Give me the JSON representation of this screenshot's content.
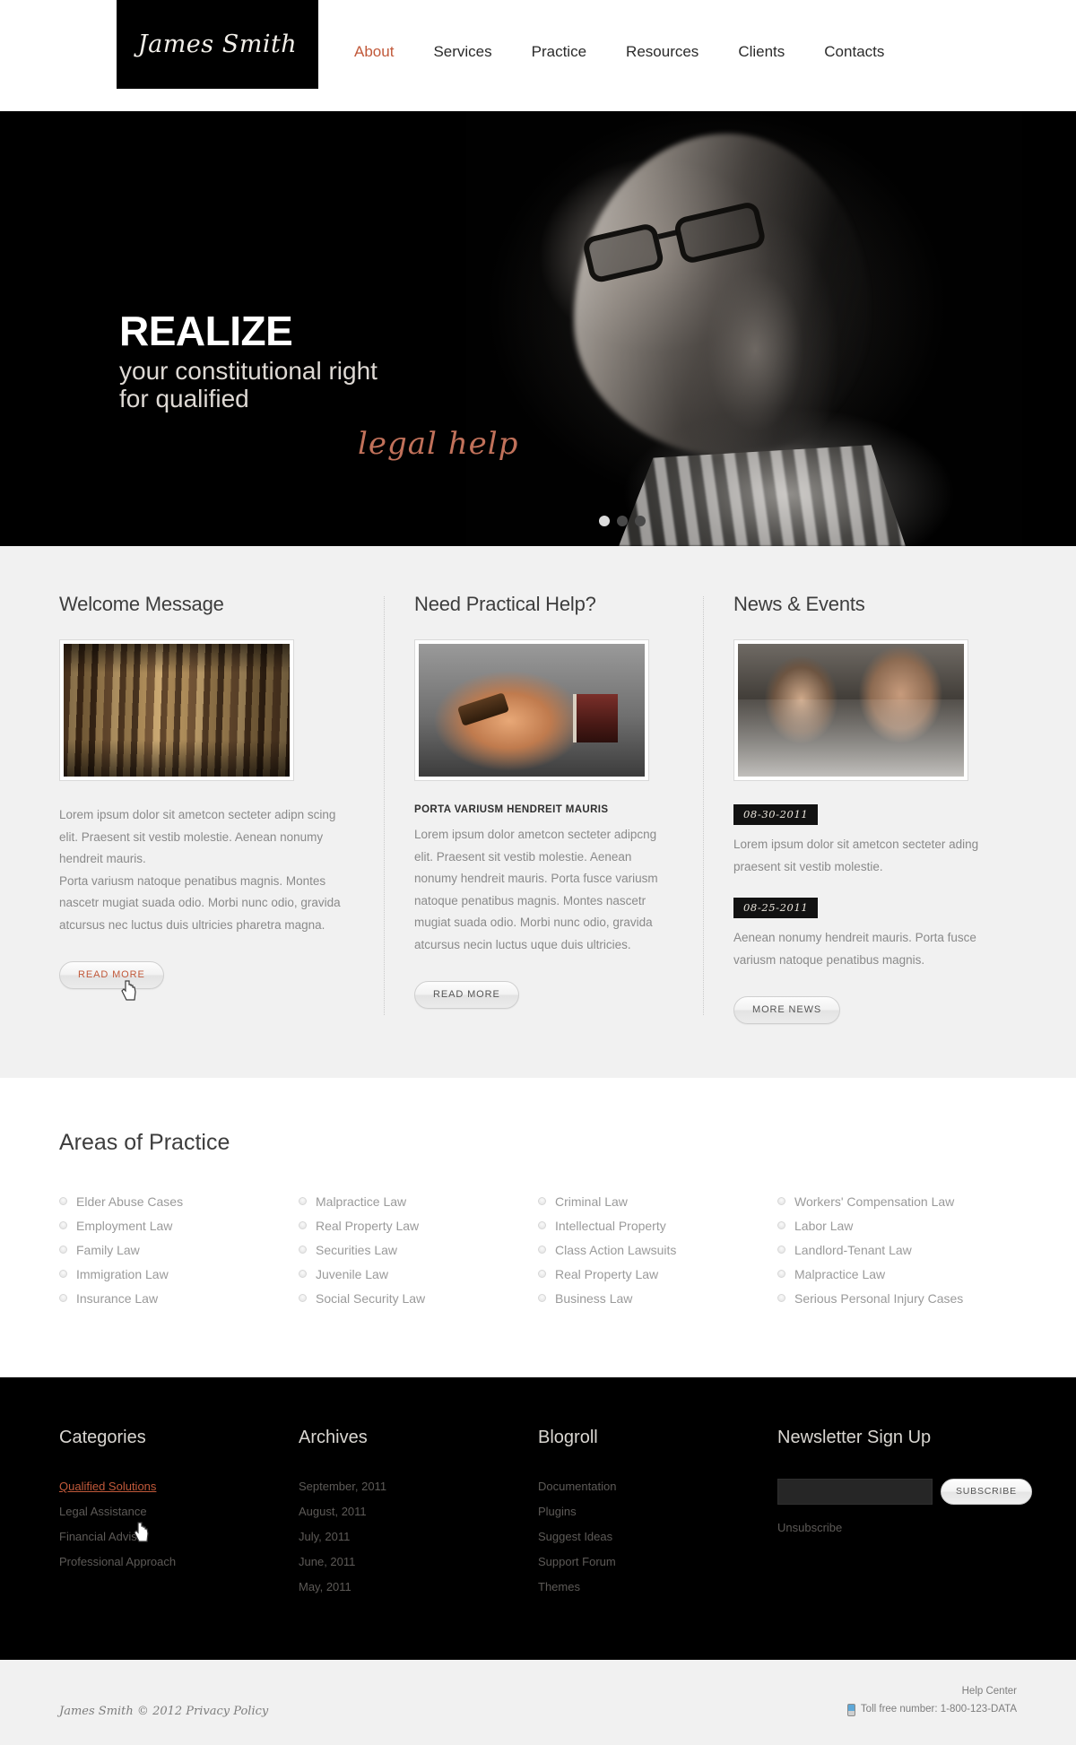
{
  "header": {
    "logo": "James Smith",
    "nav": [
      {
        "label": "About",
        "active": true
      },
      {
        "label": "Services",
        "active": false
      },
      {
        "label": "Practice",
        "active": false
      },
      {
        "label": "Resources",
        "active": false
      },
      {
        "label": "Clients",
        "active": false
      },
      {
        "label": "Contacts",
        "active": false
      }
    ]
  },
  "hero": {
    "headline": "REALIZE",
    "line1": "your constitutional right",
    "line2": "for qualified",
    "script": "legal help",
    "slides": 3,
    "active_slide": 1,
    "accent_color": "#c1715a"
  },
  "columns": [
    {
      "title": "Welcome Message",
      "image": "law-books-shelf-image",
      "paragraph1": "Lorem ipsum dolor sit ametcon secteter adipn scing elit. Praesent sit vestib molestie. Aenean nonumy hendreit mauris.",
      "paragraph2": "Porta variusm natoque penatibus magnis. Montes nascetr mugiat suada odio. Morbi nunc odio, gravida atcursus nec luctus  duis ultricies pharetra magna.",
      "button": "READ MORE"
    },
    {
      "title": "Need Practical Help?",
      "image": "gavel-and-books-image",
      "subhead": "PORTA VARIUSM HENDREIT MAURIS",
      "paragraph1": "Lorem ipsum dolor ametcon secteter adipcng elit. Praesent sit vestib molestie. Aenean nonumy hendreit mauris. Porta fusce variusm natoque penatibus magnis. Montes nascetr mugiat suada odio. Morbi nunc odio, gravida atcursus necin luctus  uque duis ultricies.",
      "button": "READ MORE"
    },
    {
      "title": "News & Events",
      "image": "smiling-people-image",
      "news": [
        {
          "date": "08-30-2011",
          "text": "Lorem ipsum dolor sit ametcon secteter ading praesent sit vestib molestie."
        },
        {
          "date": "08-25-2011",
          "text": "Aenean nonumy hendreit mauris. Porta fusce variusm natoque penatibus magnis."
        }
      ],
      "button": "MORE NEWS"
    }
  ],
  "practice": {
    "title": "Areas of Practice",
    "columns": [
      [
        "Elder Abuse Cases",
        "Employment Law",
        "Family Law",
        "Immigration Law",
        "Insurance Law"
      ],
      [
        "Malpractice Law",
        "Real Property Law",
        "Securities Law",
        "Juvenile Law",
        "Social Security Law"
      ],
      [
        "Criminal Law",
        "Intellectual Property",
        "Class Action Lawsuits",
        "Real Property Law",
        "Business Law"
      ],
      [
        "Workers' Compensation Law",
        "Labor Law",
        "Landlord-Tenant Law",
        "Malpractice Law",
        "Serious Personal Injury Cases"
      ]
    ]
  },
  "footer": {
    "categories": {
      "title": "Categories",
      "items": [
        {
          "label": "Qualified Solutions",
          "hover": true
        },
        {
          "label": "Legal Assistance",
          "hover": false
        },
        {
          "label": "Financial Advisor",
          "hover": false
        },
        {
          "label": "Professional Approach",
          "hover": false
        }
      ]
    },
    "archives": {
      "title": "Archives",
      "items": [
        "September, 2011",
        "August, 2011",
        "July, 2011",
        "June, 2011",
        "May, 2011"
      ]
    },
    "blogroll": {
      "title": "Blogroll",
      "items": [
        "Documentation",
        "Plugins",
        "Suggest Ideas",
        "Support Forum",
        "Themes"
      ]
    },
    "newsletter": {
      "title": "Newsletter Sign Up",
      "input_value": "",
      "input_placeholder": "",
      "subscribe_label": "SUBSCRIBE",
      "unsubscribe_label": "Unsubscribe"
    }
  },
  "copyright": {
    "brand": "James Smith",
    "symbol": "©",
    "year_policy": "2012 Privacy Policy",
    "help_center": "Help Center",
    "toll_free": "Toll free number: 1-800-123-DATA"
  }
}
